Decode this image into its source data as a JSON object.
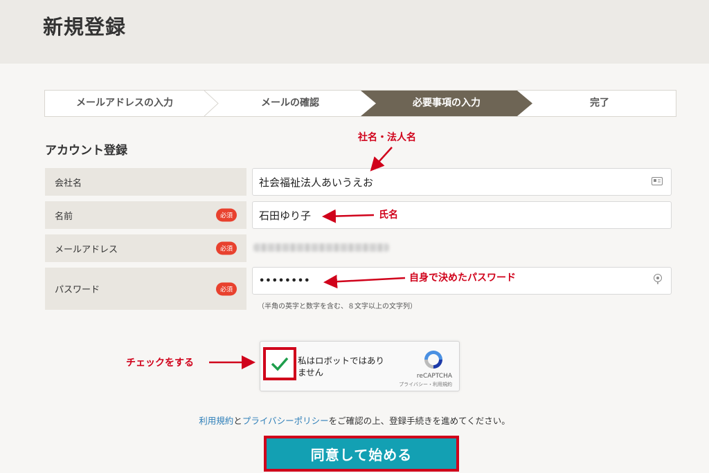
{
  "page": {
    "title": "新規登録"
  },
  "steps": [
    {
      "label": "メールアドレスの入力",
      "active": false
    },
    {
      "label": "メールの確認",
      "active": false
    },
    {
      "label": "必要事項の入力",
      "active": true
    },
    {
      "label": "完了",
      "active": false
    }
  ],
  "form": {
    "section_title": "アカウント登録",
    "required_badge": "必須",
    "company": {
      "label": "会社名",
      "value": "社会福祉法人あいうえお"
    },
    "name": {
      "label": "名前",
      "value": "石田ゆり子"
    },
    "email": {
      "label": "メールアドレス"
    },
    "password": {
      "label": "パスワード",
      "value": "••••••••",
      "hint": "（半角の英字と数字を含む、８文字以上の文字列）"
    }
  },
  "recaptcha": {
    "label": "私はロボットではありません",
    "label_line1": "私はロボットではあり",
    "label_line2": "ません",
    "brand": "reCAPTCHA",
    "links": "プライバシー・利用規約"
  },
  "terms": {
    "link1": "利用規約",
    "connector": "と",
    "link2": "プライバシーポリシー",
    "rest": "をご確認の上、登録手続きを進めてください。"
  },
  "submit": {
    "label": "同意して始める"
  },
  "annotations": {
    "company": "社名・法人名",
    "name": "氏名",
    "password": "自身で決めたパスワード",
    "check": "チェックをする"
  },
  "colors": {
    "accent": "#13a0b3",
    "step_active": "#6e6555",
    "required": "#e8412e",
    "annotation": "#d0021b",
    "link": "#2d7eb8"
  }
}
